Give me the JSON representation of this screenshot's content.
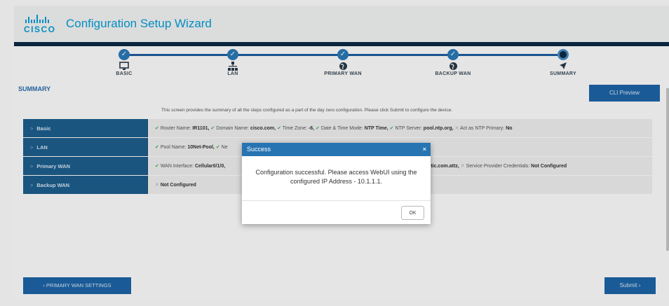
{
  "app": {
    "logo_text": "CISCO",
    "title": "Configuration Setup Wizard"
  },
  "steps": [
    {
      "label": "BASIC",
      "status": "complete",
      "icon": "monitor-icon"
    },
    {
      "label": "LAN",
      "status": "complete",
      "icon": "network-icon"
    },
    {
      "label": "PRIMARY WAN",
      "status": "complete",
      "icon": "globe-icon"
    },
    {
      "label": "BACKUP WAN",
      "status": "complete",
      "icon": "globe-icon"
    },
    {
      "label": "SUMMARY",
      "status": "current",
      "icon": "arrow-icon"
    }
  ],
  "summary": {
    "title": "SUMMARY",
    "cli_preview": "CLI Preview",
    "intro": "This screen provides the summary of all the steps configured as a part of the day zero configuration. Please click Submit to configure the device."
  },
  "rows": [
    {
      "label": "Basic",
      "items": [
        {
          "k": "Router Name:",
          "v": "IR1101,",
          "ok": true
        },
        {
          "k": "Domain Name:",
          "v": "cisco.com,",
          "ok": true
        },
        {
          "k": "Time Zone:",
          "v": "-6,",
          "ok": true
        },
        {
          "k": "Date & Time Mode:",
          "v": "NTP Time,",
          "ok": true
        },
        {
          "k": "NTP Server:",
          "v": "pool.ntp.org,",
          "ok": true
        },
        {
          "k": "Act as NTP Primary:",
          "v": "No",
          "ok": false
        }
      ]
    },
    {
      "label": "LAN",
      "items": [
        {
          "k": "Pool Name:",
          "v": "10Net-Pool,",
          "ok": true
        },
        {
          "k": "Ne",
          "v": "",
          "ok": true
        }
      ]
    },
    {
      "label": "Primary WAN",
      "items": [
        {
          "k": "WAN Interface:",
          "v": "Cellular0/1/0,",
          "ok": true
        },
        {
          "k": "",
          "v": "iscoKinetic.com.attz,",
          "ok": null
        },
        {
          "k": "Service Provider Credentials:",
          "v": "Not Configured",
          "ok": false
        }
      ]
    },
    {
      "label": "Backup WAN",
      "items": [
        {
          "k": "",
          "v": "Not Configured",
          "ok": false
        }
      ]
    }
  ],
  "modal": {
    "title": "Success",
    "close": "×",
    "message": "Configuration successful. Please access WebUI using the configured IP Address - 10.1.1.1.",
    "ok": "OK"
  },
  "footer": {
    "prev": "‹ PRIMARY WAN SETTINGS",
    "submit": "Submit ›"
  },
  "colors": {
    "brand": "#049fd9",
    "primary": "#1d66a9",
    "row_header": "#1e5f8e",
    "check": "#4caf50"
  }
}
